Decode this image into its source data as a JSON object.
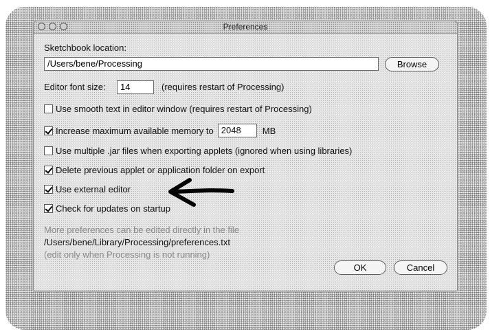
{
  "window": {
    "title": "Preferences"
  },
  "sketchbook": {
    "label": "Sketchbook location:",
    "path": "/Users/bene/Processing",
    "browse_label": "Browse"
  },
  "font": {
    "label": "Editor font size:",
    "value": "14",
    "note": "(requires restart of Processing)"
  },
  "options": {
    "smooth_text": {
      "label": "Use smooth text in editor window (requires restart of Processing)",
      "checked": false
    },
    "max_memory": {
      "label": "Increase maximum available memory to",
      "checked": true,
      "value": "2048",
      "unit": "MB"
    },
    "multiple_jar": {
      "label": "Use multiple .jar files when exporting applets (ignored when using libraries)",
      "checked": false
    },
    "delete_previous": {
      "label": "Delete previous applet or application folder on export",
      "checked": true
    },
    "external_editor": {
      "label": "Use external editor",
      "checked": true
    },
    "check_updates": {
      "label": "Check for updates on startup",
      "checked": true
    }
  },
  "footer": {
    "more_prefs": "More preferences can be edited directly in the file",
    "prefs_path": "/Users/bene/Library/Processing/preferences.txt",
    "edit_note": "(edit only when Processing is not running)"
  },
  "buttons": {
    "ok": "OK",
    "cancel": "Cancel"
  },
  "annotation": {
    "arrow_color": "#000000"
  }
}
